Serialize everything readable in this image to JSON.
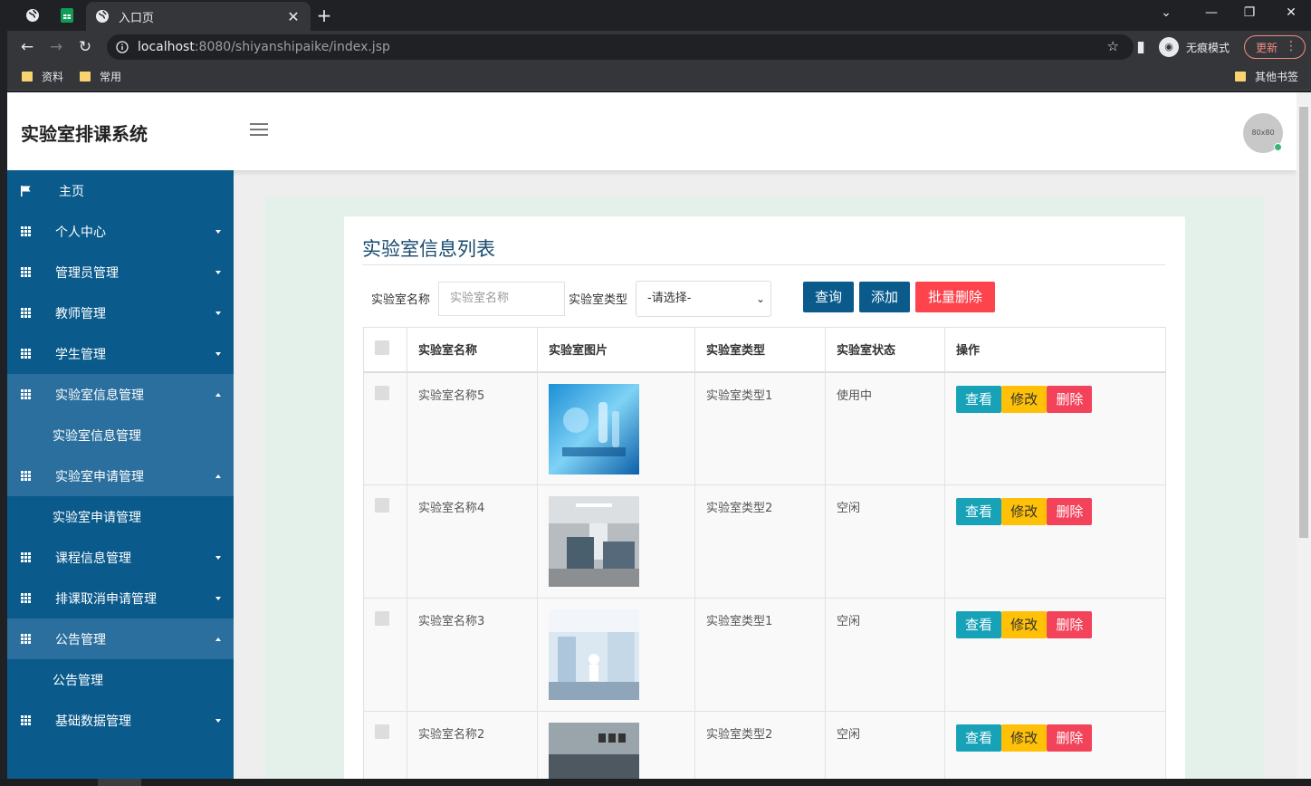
{
  "browser": {
    "active_tab_title": "入口页",
    "url_host": "localhost",
    "url_rest": ":8080/shiyanshipaike/index.jsp",
    "incognito_label": "无痕模式",
    "update_label": "更新",
    "bookmarks": [
      "资料",
      "常用"
    ],
    "other_bookmarks": "其他书签"
  },
  "app": {
    "brand": "实验室排课系统",
    "avatar_text": "80x80"
  },
  "sidebar": {
    "items": [
      {
        "label": "主页"
      },
      {
        "label": "个人中心"
      },
      {
        "label": "管理员管理"
      },
      {
        "label": "教师管理"
      },
      {
        "label": "学生管理"
      },
      {
        "label": "实验室信息管理"
      },
      {
        "label": "实验室信息管理"
      },
      {
        "label": "实验室申请管理"
      },
      {
        "label": "实验室申请管理"
      },
      {
        "label": "课程信息管理"
      },
      {
        "label": "排课取消申请管理"
      },
      {
        "label": "公告管理"
      },
      {
        "label": "公告管理"
      },
      {
        "label": "基础数据管理"
      }
    ]
  },
  "main": {
    "title": "实验室信息列表",
    "filters": {
      "name_label": "实验室名称",
      "name_placeholder": "实验室名称",
      "type_label": "实验室类型",
      "type_selected": "-请选择-"
    },
    "buttons": {
      "query": "查询",
      "add": "添加",
      "batch_delete": "批量删除"
    },
    "table": {
      "headers": [
        "实验室名称",
        "实验室图片",
        "实验室类型",
        "实验室状态",
        "操作"
      ],
      "rows": [
        {
          "name": "实验室名称5",
          "type": "实验室类型1",
          "status": "使用中"
        },
        {
          "name": "实验室名称4",
          "type": "实验室类型2",
          "status": "空闲"
        },
        {
          "name": "实验室名称3",
          "type": "实验室类型1",
          "status": "空闲"
        },
        {
          "name": "实验室名称2",
          "type": "实验室类型2",
          "status": "空闲"
        }
      ],
      "actions": {
        "view": "查看",
        "edit": "修改",
        "delete": "删除"
      }
    }
  },
  "colors": {
    "sidebar": "#0a5a8c",
    "primary_button": "#0a5a8c",
    "danger_button": "#fd434b",
    "view_button": "#17a2b8",
    "edit_button": "#ffc107"
  }
}
